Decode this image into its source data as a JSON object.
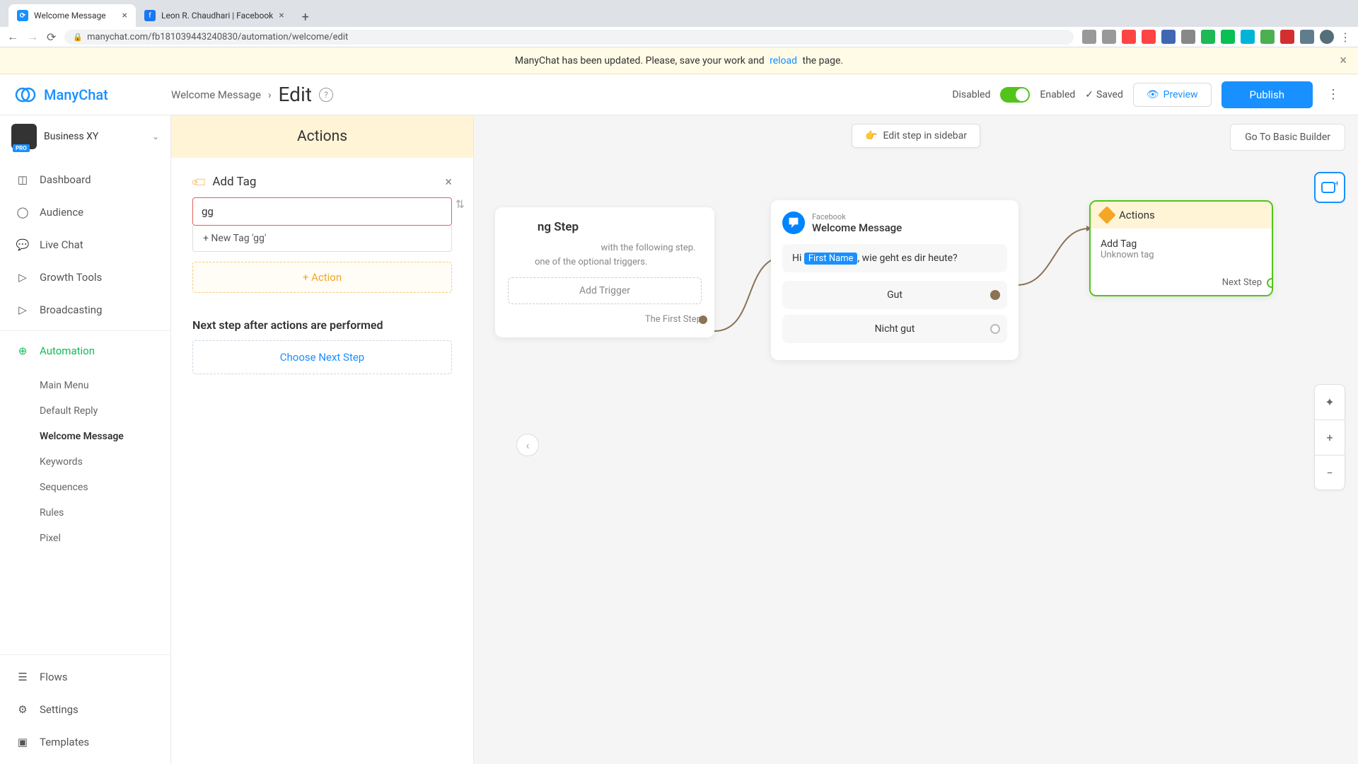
{
  "browser": {
    "tabs": [
      {
        "title": "Welcome Message",
        "favicon": "mc"
      },
      {
        "title": "Leon R. Chaudhari | Facebook",
        "favicon": "fb"
      }
    ],
    "url": "manychat.com/fb181039443240830/automation/welcome/edit"
  },
  "notification": {
    "prefix": "ManyChat has been updated. Please, save your work and ",
    "link": "reload",
    "suffix": " the page."
  },
  "header": {
    "logo": "ManyChat",
    "breadcrumb": "Welcome Message",
    "page": "Edit",
    "disabled": "Disabled",
    "enabled": "Enabled",
    "saved": "Saved",
    "preview": "Preview",
    "publish": "Publish"
  },
  "workspace": {
    "name": "Business XY",
    "badge": "PRO"
  },
  "nav": {
    "dashboard": "Dashboard",
    "audience": "Audience",
    "livechat": "Live Chat",
    "growth": "Growth Tools",
    "broadcasting": "Broadcasting",
    "automation": "Automation",
    "flows": "Flows",
    "settings": "Settings",
    "templates": "Templates",
    "sub": {
      "mainmenu": "Main Menu",
      "defaultreply": "Default Reply",
      "welcome": "Welcome Message",
      "keywords": "Keywords",
      "sequences": "Sequences",
      "rules": "Rules",
      "pixel": "Pixel"
    }
  },
  "actionsPanel": {
    "title": "Actions",
    "addTag": "Add Tag",
    "inputValue": "gg",
    "newTagOption": "+ New Tag 'gg'",
    "addAction": "+ Action",
    "nextStepLabel": "Next step after actions are performed",
    "chooseNext": "Choose Next Step"
  },
  "canvas": {
    "editStep": "Edit step in sidebar",
    "basicBuilder": "Go To Basic Builder",
    "startingNode": {
      "titleSuffix": "ng Step",
      "desc1": "with the following step.",
      "desc2": "one of the optional triggers.",
      "addTrigger": "Add Trigger",
      "firstStep": "The First Step"
    },
    "messageNode": {
      "channel": "Facebook",
      "title": "Welcome Message",
      "greeting_prefix": "Hi ",
      "variable": "First Name",
      "greeting_suffix": ", wie geht es dir heute?",
      "reply1": "Gut",
      "reply2": "Nicht gut"
    },
    "actionsNode": {
      "title": "Actions",
      "item": "Add Tag",
      "itemSub": "Unknown tag",
      "nextStep": "Next Step"
    }
  }
}
